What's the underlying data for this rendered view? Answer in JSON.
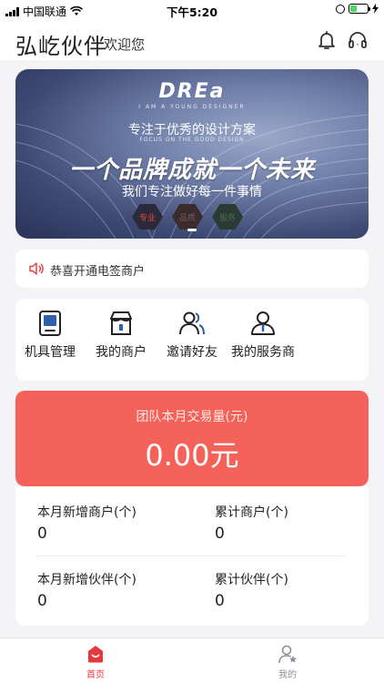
{
  "status_bar": {
    "carrier": "中国联通",
    "time": "下午5:20"
  },
  "header": {
    "brand": "弘屹伙伴",
    "welcome": "欢迎您",
    "icons": [
      "bell-icon",
      "headset-icon"
    ]
  },
  "banner": {
    "logo": "DREa",
    "logo_sub": "I AM A YOUNG DESIGNER",
    "tagline": "专注于优秀的设计方案",
    "tagline_en": "FOCUS ON THE GOOD DESIGN",
    "headline": "一个品牌成就一个未来",
    "subline": "我们专注做好每一件事情",
    "hex_labels": [
      "专业",
      "品质",
      "服务"
    ]
  },
  "notice": {
    "icon": "speaker-icon",
    "text": "恭喜开通电签商户"
  },
  "quick_actions": [
    {
      "label": "机具管理",
      "icon": "terminal-icon"
    },
    {
      "label": "我的商户",
      "icon": "store-icon"
    },
    {
      "label": "邀请好友",
      "icon": "invite-users-icon"
    },
    {
      "label": "我的服务商",
      "icon": "service-provider-icon"
    }
  ],
  "team_volume": {
    "label": "团队本月交易量(元)",
    "value": "0.00元"
  },
  "stats": {
    "new_merchants_label": "本月新增商户(个)",
    "new_merchants_value": "0",
    "total_merchants_label": "累计商户(个)",
    "total_merchants_value": "0",
    "new_partners_label": "本月新增伙伴(个)",
    "new_partners_value": "0",
    "total_partners_label": "累计伙伴(个)",
    "total_partners_value": "0"
  },
  "tabbar": {
    "home_label": "首页",
    "mine_label": "我的",
    "active": "home"
  },
  "colors": {
    "accent": "#f4625a",
    "tab_active": "#e5383b",
    "tab_inactive": "#8a8f9e",
    "icon_blue": "#2f5fa8"
  }
}
